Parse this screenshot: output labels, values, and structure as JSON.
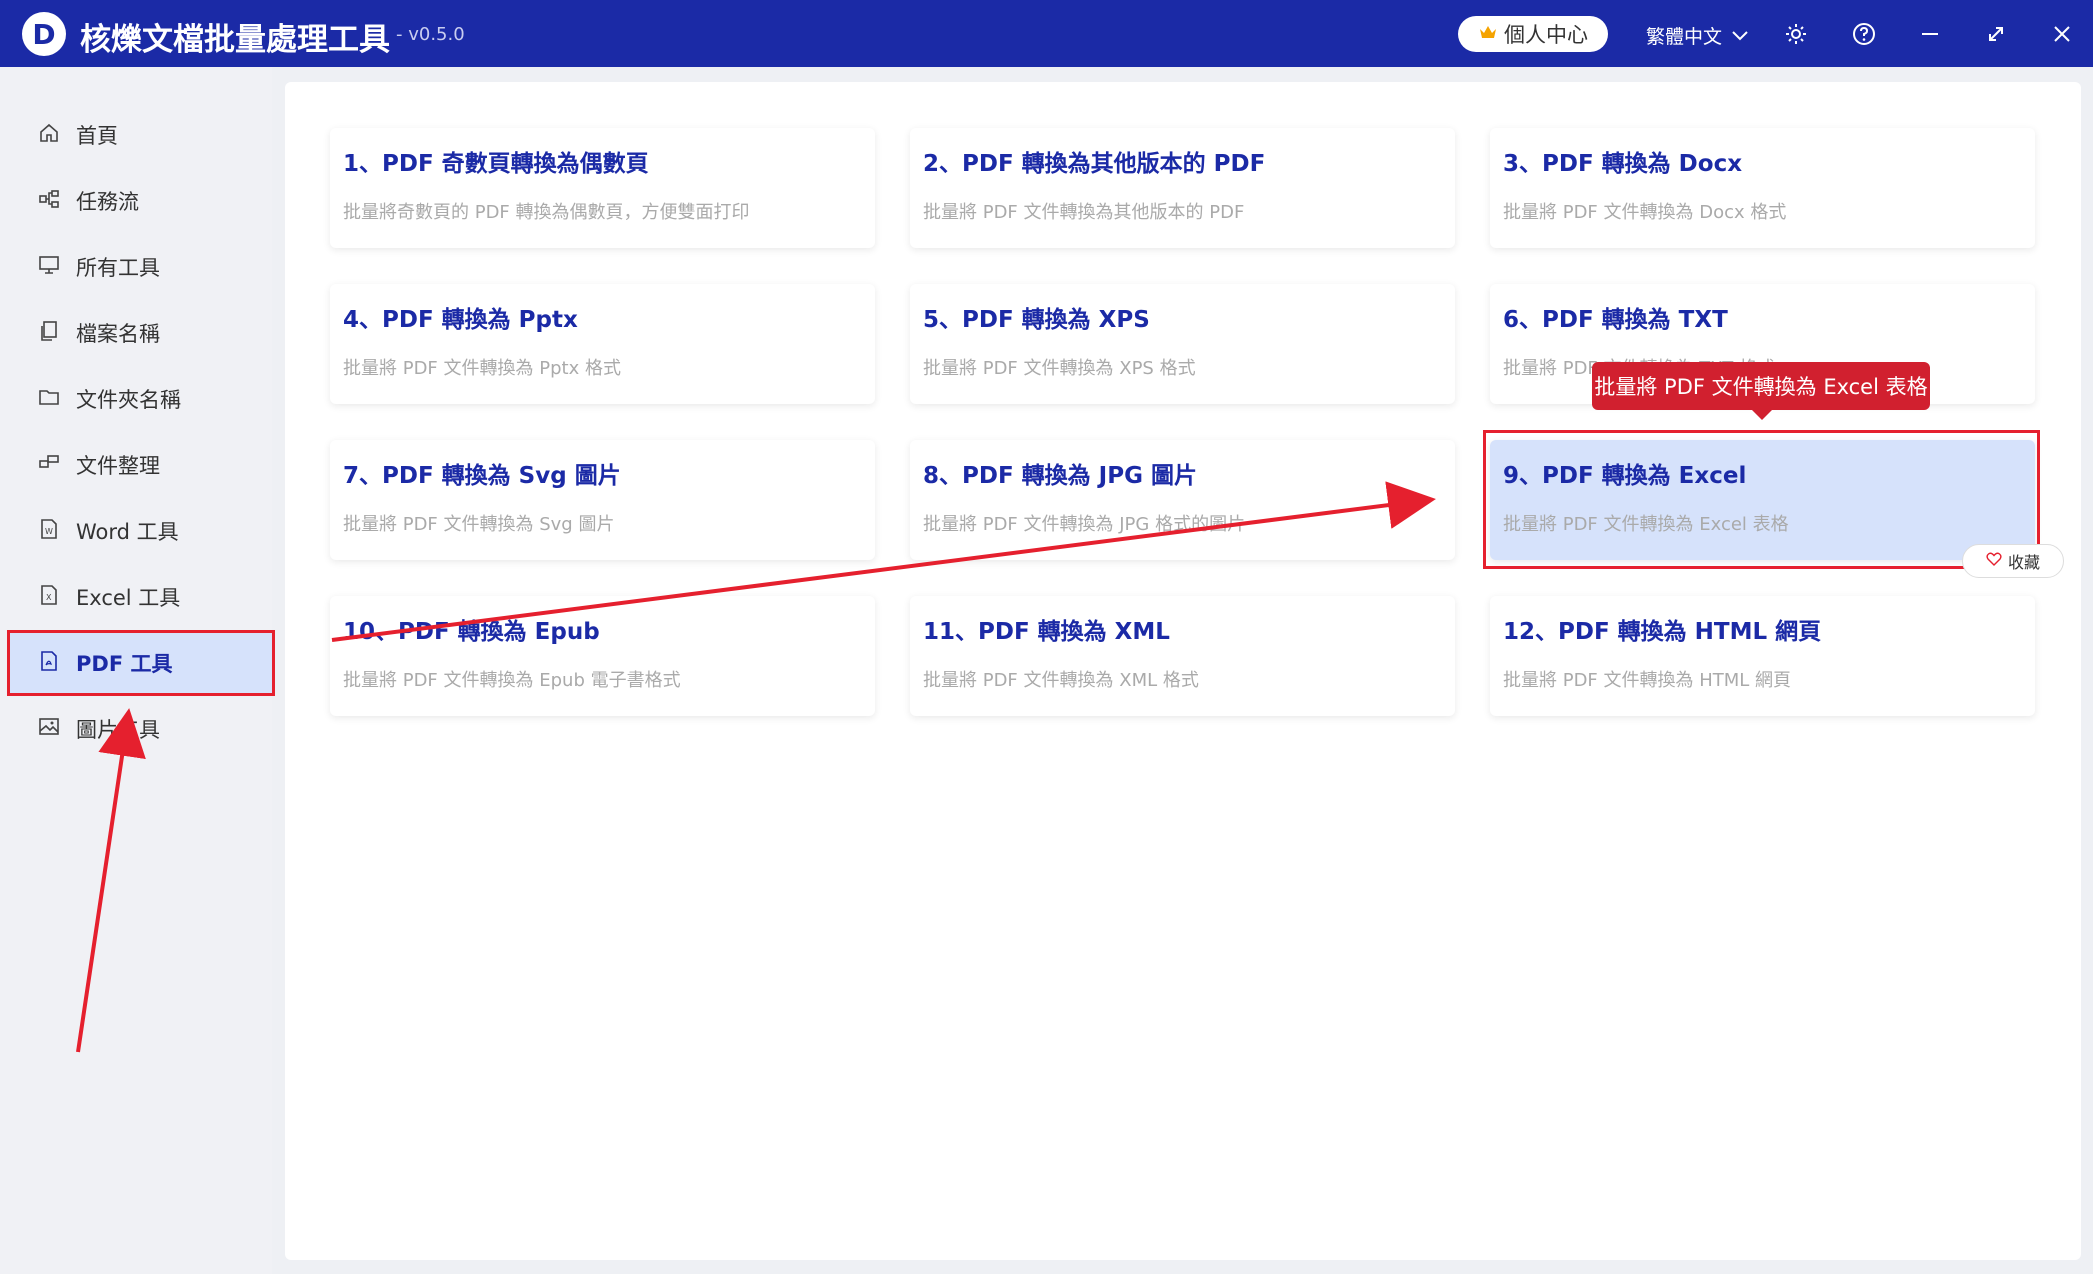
{
  "app": {
    "title": "核爍文檔批量處理工具",
    "version": "- v0.5.0",
    "logo_letter": "D"
  },
  "titlebar": {
    "vip_label": "個人中心",
    "language": "繁體中文",
    "icons": [
      "crown-icon",
      "chevron-down-icon",
      "gear-icon",
      "help-icon",
      "minimize-icon",
      "maximize-icon",
      "close-icon"
    ]
  },
  "sidebar": {
    "items": [
      {
        "label": "首頁",
        "icon": "home-icon"
      },
      {
        "label": "任務流",
        "icon": "workflow-icon"
      },
      {
        "label": "所有工具",
        "icon": "monitor-icon"
      },
      {
        "label": "檔案名稱",
        "icon": "file-copy-icon"
      },
      {
        "label": "文件夾名稱",
        "icon": "folder-icon"
      },
      {
        "label": "文件整理",
        "icon": "organize-icon"
      },
      {
        "label": "Word 工具",
        "icon": "word-icon"
      },
      {
        "label": "Excel 工具",
        "icon": "excel-icon"
      },
      {
        "label": "PDF 工具",
        "icon": "pdf-icon",
        "active": true
      },
      {
        "label": "圖片工具",
        "icon": "image-icon"
      }
    ]
  },
  "tools": [
    {
      "title": "1、PDF 奇數頁轉換為偶數頁",
      "desc": "批量將奇數頁的 PDF 轉換為偶數頁，方便雙面打印"
    },
    {
      "title": "2、PDF 轉換為其他版本的 PDF",
      "desc": "批量將 PDF 文件轉換為其他版本的 PDF"
    },
    {
      "title": "3、PDF 轉換為 Docx",
      "desc": "批量將 PDF 文件轉換為 Docx 格式"
    },
    {
      "title": "4、PDF 轉換為 Pptx",
      "desc": "批量將 PDF 文件轉換為 Pptx 格式"
    },
    {
      "title": "5、PDF 轉換為 XPS",
      "desc": "批量將 PDF 文件轉換為 XPS 格式"
    },
    {
      "title": "6、PDF 轉換為 TXT",
      "desc": "批量將 PDF 文件轉換為 TXT 格式"
    },
    {
      "title": "7、PDF 轉換為 Svg 圖片",
      "desc": "批量將 PDF 文件轉換為 Svg 圖片"
    },
    {
      "title": "8、PDF 轉換為 JPG 圖片",
      "desc": "批量將 PDF 文件轉換為 JPG 格式的圖片"
    },
    {
      "title": "9、PDF 轉換為 Excel",
      "desc": "批量將 PDF 文件轉換為 Excel 表格",
      "highlighted": true
    },
    {
      "title": "10、PDF 轉換為 Epub",
      "desc": "批量將 PDF 文件轉換為 Epub 電子書格式"
    },
    {
      "title": "11、PDF 轉換為 XML",
      "desc": "批量將 PDF 文件轉換為 XML 格式"
    },
    {
      "title": "12、PDF 轉換為 HTML 網頁",
      "desc": "批量將 PDF 文件轉換為 HTML 網頁"
    }
  ],
  "tooltip": {
    "text": "批量將 PDF 文件轉換為 Excel 表格"
  },
  "favorite": {
    "label": "收藏"
  },
  "colors": {
    "titlebar": "#1b2aa6",
    "accent_text": "#1b2aa6",
    "highlight_card": "#d6e2fb",
    "annotation_red": "#e5202e"
  }
}
